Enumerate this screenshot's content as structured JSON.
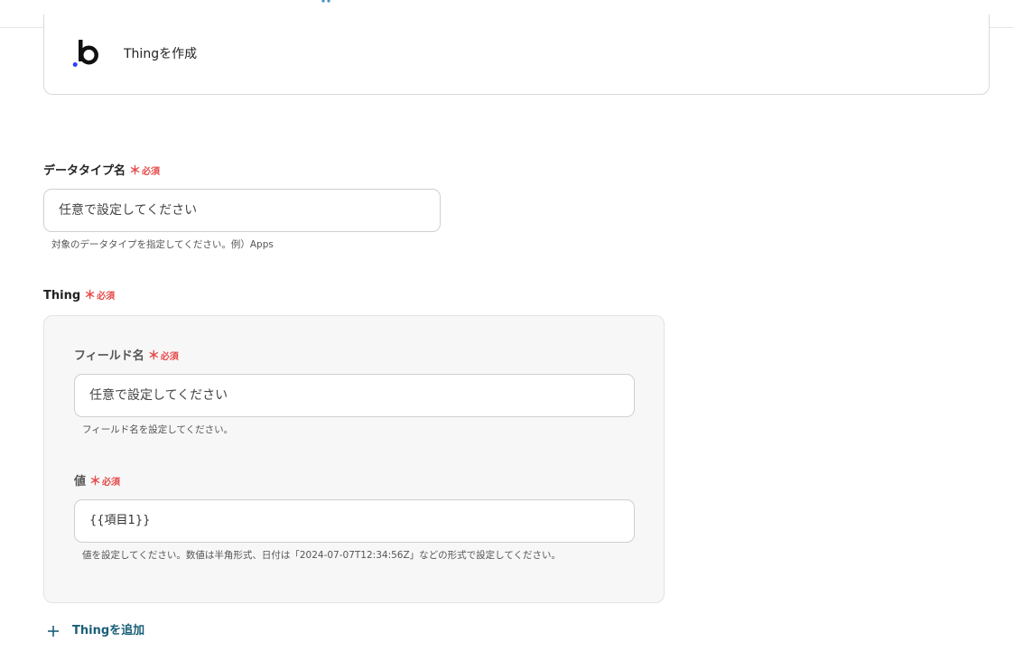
{
  "app": {
    "action_label": "Thingを作成"
  },
  "labels": {
    "required_mark": "＊",
    "required_text": "必須"
  },
  "data_type": {
    "label": "データタイプ名",
    "placeholder": "任意で設定してください",
    "help": "対象のデータタイプを指定してください。例）Apps"
  },
  "thing": {
    "label": "Thing",
    "field_name": {
      "label": "フィールド名",
      "placeholder": "任意で設定してください",
      "help": "フィールド名を設定してください。"
    },
    "value": {
      "label": "値",
      "value": "{{項目1}}",
      "help": "値を設定してください。数値は半角形式、日付は「2024-07-07T12:34:56Z」などの形式で設定してください。"
    }
  },
  "add_thing": {
    "label": "Thingを追加"
  },
  "colors": {
    "required": "#e64a4a",
    "accent": "#1a5f78",
    "logo_dot": "#2f3bff"
  }
}
